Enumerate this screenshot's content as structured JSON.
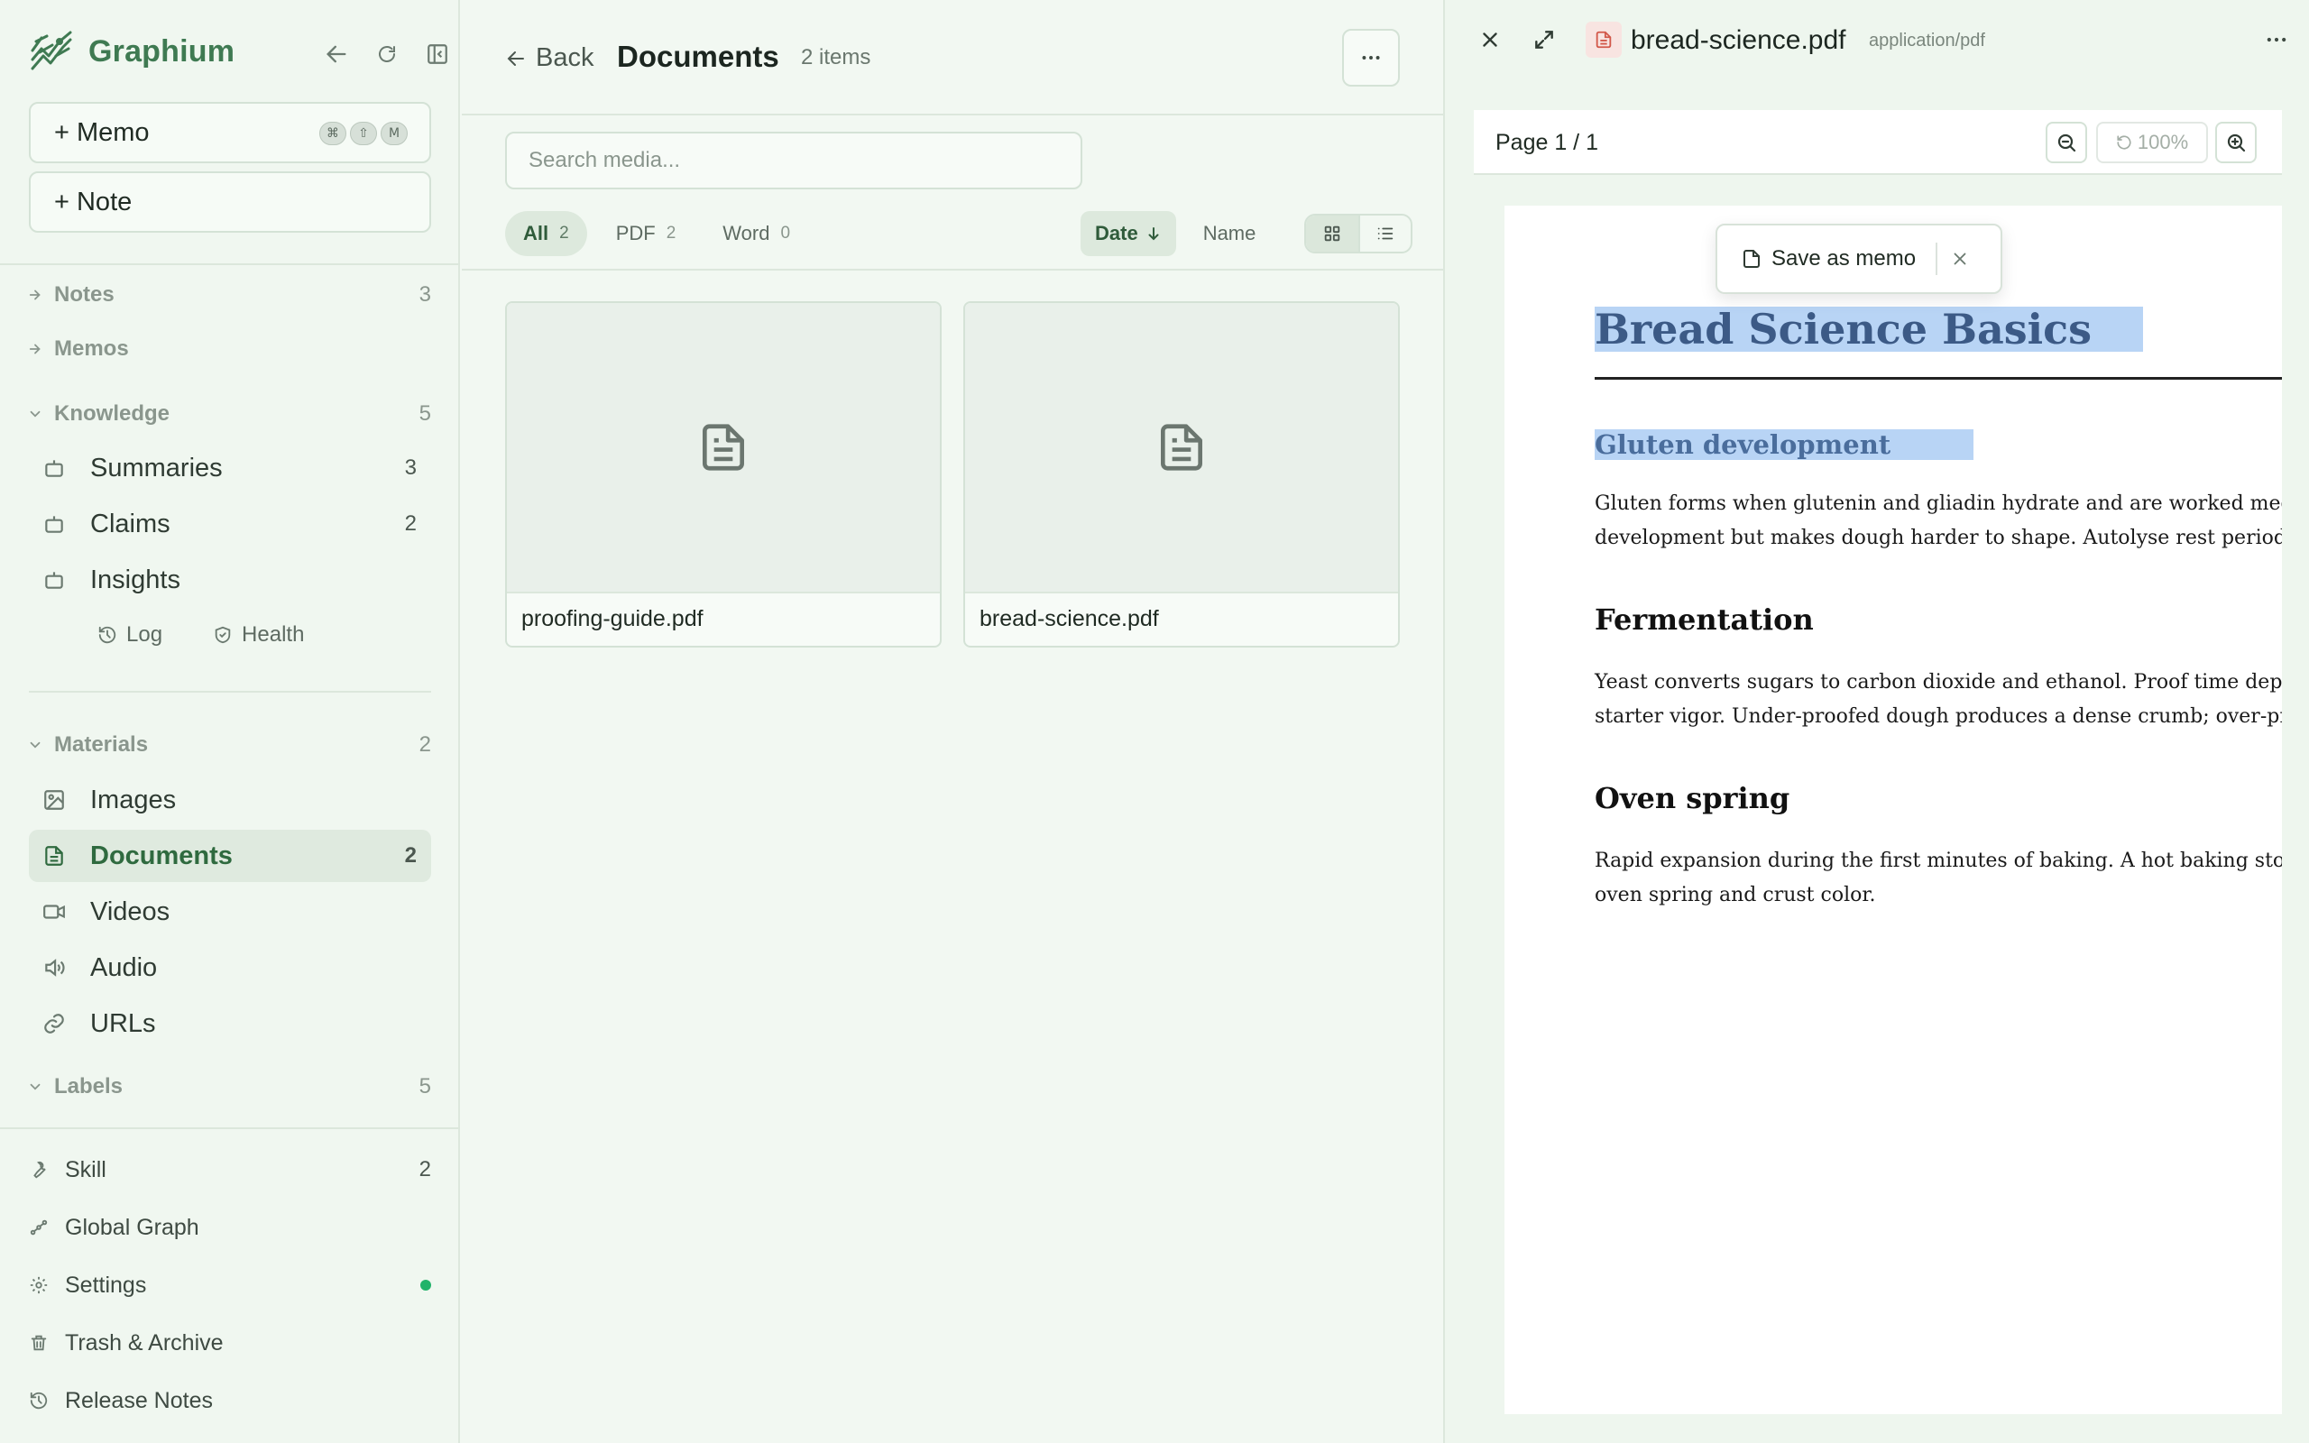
{
  "app": {
    "brand": "Graphium"
  },
  "sidebar": {
    "memo_button": "+ Memo",
    "memo_shortcut": [
      "⌘",
      "⇧",
      "M"
    ],
    "note_button": "+ Note",
    "notes": {
      "label": "Notes",
      "count": "3"
    },
    "memos": {
      "label": "Memos"
    },
    "knowledge": {
      "label": "Knowledge",
      "count": "5",
      "items": [
        {
          "label": "Summaries",
          "count": "3",
          "icon": "bot-icon"
        },
        {
          "label": "Claims",
          "count": "2",
          "icon": "bot-icon"
        },
        {
          "label": "Insights",
          "count": "",
          "icon": "bot-icon"
        }
      ],
      "log": "Log",
      "health": "Health"
    },
    "materials": {
      "label": "Materials",
      "count": "2",
      "items": [
        {
          "label": "Images",
          "count": "",
          "icon": "image-icon"
        },
        {
          "label": "Documents",
          "count": "2",
          "icon": "document-icon"
        },
        {
          "label": "Videos",
          "count": "",
          "icon": "video-icon"
        },
        {
          "label": "Audio",
          "count": "",
          "icon": "speaker-icon"
        },
        {
          "label": "URLs",
          "count": "",
          "icon": "link-icon"
        }
      ]
    },
    "labels": {
      "label": "Labels",
      "count": "5"
    },
    "footer": {
      "skill": {
        "label": "Skill",
        "count": "2"
      },
      "graph": {
        "label": "Global Graph"
      },
      "settings": {
        "label": "Settings"
      },
      "trash": {
        "label": "Trash & Archive"
      },
      "release": {
        "label": "Release Notes"
      }
    }
  },
  "documents": {
    "back": "Back",
    "title": "Documents",
    "count": "2 items",
    "search_placeholder": "Search media...",
    "filters": [
      {
        "label": "All",
        "count": "2"
      },
      {
        "label": "PDF",
        "count": "2"
      },
      {
        "label": "Word",
        "count": "0"
      }
    ],
    "sort_date": "Date",
    "sort_name": "Name",
    "files": [
      "proofing-guide.pdf",
      "bread-science.pdf"
    ]
  },
  "viewer": {
    "filename": "bread-science.pdf",
    "mime": "application/pdf",
    "page": "Page 1 / 1",
    "zoom": "100%",
    "popover_save": "Save as memo",
    "doc": {
      "title": "Bread Science Basics",
      "h_gluten": "Gluten development",
      "p_gluten_1": "Gluten forms when glutenin and gliadin hydrate and are worked mechani",
      "p_gluten_2": "development but makes dough harder to shape. Autolyse rest periods let t",
      "h_ferment": "Fermentation",
      "p_ferment_1": "Yeast converts sugars to carbon dioxide and ethanol. Proof time depends",
      "p_ferment_2": "starter vigor. Under-proofed dough produces a dense crumb; over-proofe",
      "h_oven": "Oven spring",
      "p_oven_1": "Rapid expansion during the first minutes of baking. A hot baking stone ar",
      "p_oven_2": "oven spring and crust color."
    }
  },
  "colors": {
    "brand": "#3f7a52",
    "active_bg": "#dfeadf",
    "selection": "#b8d4f5",
    "status_dot": "#22b36a"
  }
}
